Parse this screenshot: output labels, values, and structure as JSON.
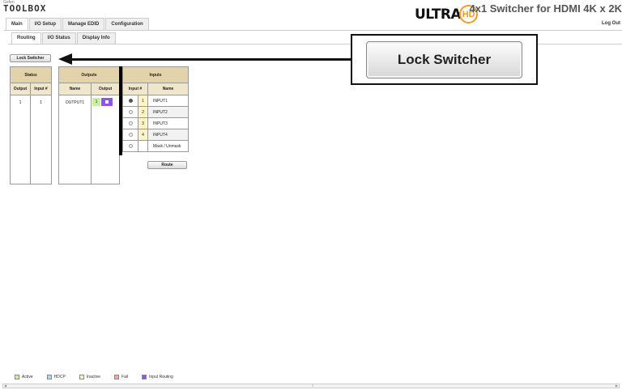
{
  "header": {
    "logo_small": "Gefen",
    "logo_main": "TOOLBOX",
    "ultra_text": "ULTRA",
    "ultra_hd": "HD",
    "product_title": "4x1 Switcher for HDMI 4K x 2K",
    "logout": "Log Out"
  },
  "main_tabs": [
    "Main",
    "I/O Setup",
    "Manage EDID",
    "Configuration"
  ],
  "sub_tabs": [
    "Routing",
    "I/O Status",
    "Display Info"
  ],
  "lock_switcher_label": "Lock Switcher",
  "status_table": {
    "title": "Status",
    "headers": [
      "Output",
      "Input #"
    ],
    "row": [
      "1",
      "1"
    ]
  },
  "outputs_table": {
    "title": "Outputs",
    "headers": [
      "Name",
      "Output"
    ],
    "name": "OUTPUT1",
    "output_num": "1"
  },
  "inputs_table": {
    "title": "Inputs",
    "headers": [
      "Input #",
      "Name"
    ],
    "rows": [
      {
        "num": "1",
        "name": "INPUT1",
        "selected": true
      },
      {
        "num": "2",
        "name": "INPUT2",
        "selected": false
      },
      {
        "num": "3",
        "name": "INPUT3",
        "selected": false
      },
      {
        "num": "4",
        "name": "INPUT4",
        "selected": false
      },
      {
        "num": "",
        "name": "Mask / Unmask",
        "selected": false
      }
    ]
  },
  "route_label": "Route",
  "callout_label": "Lock Switcher",
  "legend": [
    {
      "label": "Active",
      "color": "#c9f0a0"
    },
    {
      "label": "HDCP",
      "color": "#a8d8f0"
    },
    {
      "label": "Inactive",
      "color": "#f4f0c8"
    },
    {
      "label": "Fail",
      "color": "#f4a8a8"
    },
    {
      "label": "Input Routing",
      "color": "#8f55e8"
    }
  ]
}
